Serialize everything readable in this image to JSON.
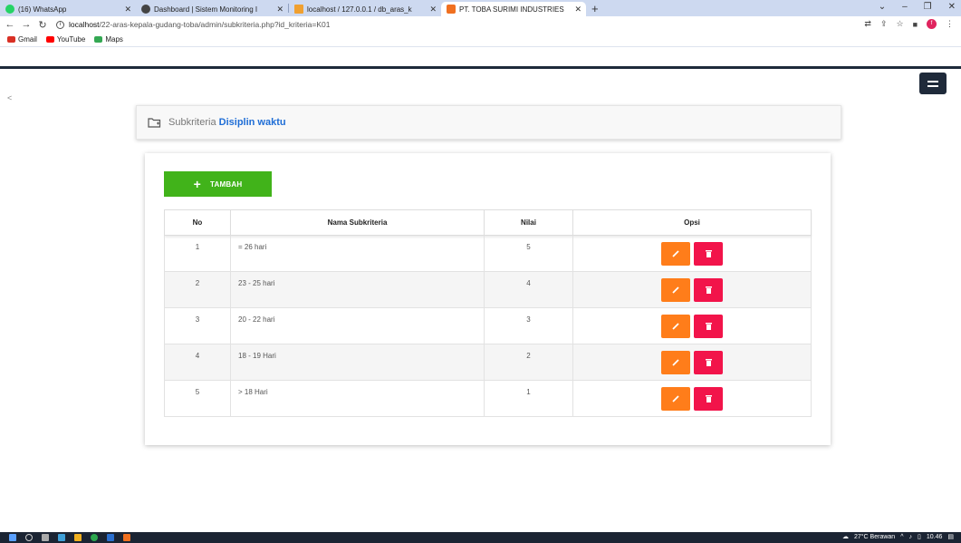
{
  "browser": {
    "tabs": [
      {
        "label": "(16) WhatsApp",
        "color": "#25d366"
      },
      {
        "label": "Dashboard | Sistem Monitoring I",
        "color": "#444"
      },
      {
        "label": "localhost / 127.0.0.1 / db_aras_k",
        "color": "#f0a030"
      },
      {
        "label": "PT. TOBA SURIMI INDUSTRIES",
        "color": "#f07020"
      }
    ],
    "new_tab": "+",
    "url_host": "localhost",
    "url_path": "/22-aras-kepala-gudang-toba/admin/subkriteria.php?id_kriteria=K01",
    "profile_initial": "f",
    "bookmarks": [
      {
        "label": "Gmail",
        "color": "#d93025"
      },
      {
        "label": "YouTube",
        "color": "#ff0000"
      },
      {
        "label": "Maps",
        "color": "#34a853"
      }
    ]
  },
  "page": {
    "collapse_arrow": "<",
    "title_prefix": "Subkriteria",
    "title_name": "Disiplin waktu",
    "add_button": "TAMBAH",
    "table": {
      "headers": [
        "No",
        "Nama Subkriteria",
        "Nilai",
        "Opsi"
      ],
      "rows": [
        {
          "no": "1",
          "nama": "= 26 hari",
          "nilai": "5"
        },
        {
          "no": "2",
          "nama": "23 - 25 hari",
          "nilai": "4"
        },
        {
          "no": "3",
          "nama": "20 - 22 hari",
          "nilai": "3"
        },
        {
          "no": "4",
          "nama": "18 - 19 Hari",
          "nilai": "2"
        },
        {
          "no": "5",
          "nama": "> 18 Hari",
          "nilai": "1"
        }
      ]
    },
    "colors": {
      "accent": "#1e6dd6",
      "add": "#41b31a",
      "edit": "#ff7d1a",
      "delete": "#f2144a",
      "navbar": "#1e2a3a"
    }
  },
  "taskbar": {
    "weather": "27°C  Berawan",
    "time": "10.46"
  }
}
